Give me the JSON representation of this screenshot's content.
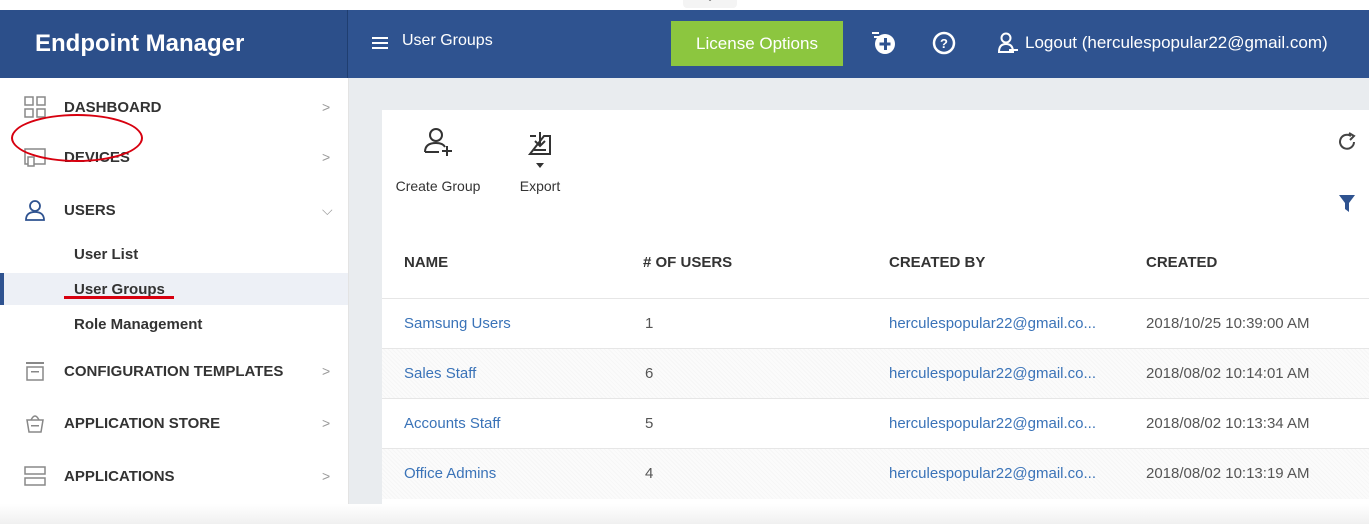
{
  "app": {
    "title": "Endpoint Manager"
  },
  "header": {
    "page_title": "User Groups",
    "notch": "⌄",
    "license_button": "License Options",
    "logout": "Logout (herculespopular22@gmail.com)"
  },
  "sidebar": {
    "items": [
      {
        "label": "DASHBOARD",
        "icon": "dashboard-icon"
      },
      {
        "label": "DEVICES",
        "icon": "devices-icon"
      },
      {
        "label": "USERS",
        "icon": "user-icon"
      },
      {
        "label": "CONFIGURATION TEMPLATES",
        "icon": "templates-icon"
      },
      {
        "label": "APPLICATION STORE",
        "icon": "store-icon"
      },
      {
        "label": "APPLICATIONS",
        "icon": "applications-icon"
      }
    ],
    "users_subitems": [
      "User List",
      "User Groups",
      "Role Management"
    ]
  },
  "toolbar": {
    "create_group": "Create Group",
    "export": "Export"
  },
  "table": {
    "columns": [
      "NAME",
      "# OF USERS",
      "CREATED BY",
      "CREATED"
    ],
    "rows": [
      {
        "name": "Samsung Users",
        "users": "1",
        "created_by": "herculespopular22@gmail.co...",
        "created": "2018/10/25 10:39:00 AM"
      },
      {
        "name": "Sales Staff",
        "users": "6",
        "created_by": "herculespopular22@gmail.co...",
        "created": "2018/08/02 10:14:01 AM"
      },
      {
        "name": "Accounts Staff",
        "users": "5",
        "created_by": "herculespopular22@gmail.co...",
        "created": "2018/08/02 10:13:34 AM"
      },
      {
        "name": "Office Admins",
        "users": "4",
        "created_by": "herculespopular22@gmail.co...",
        "created": "2018/08/02 10:13:19 AM"
      }
    ]
  },
  "colors": {
    "header": "#2f5390",
    "license": "#8cc63f",
    "link": "#3a73b8",
    "annotation": "#d7000f"
  }
}
